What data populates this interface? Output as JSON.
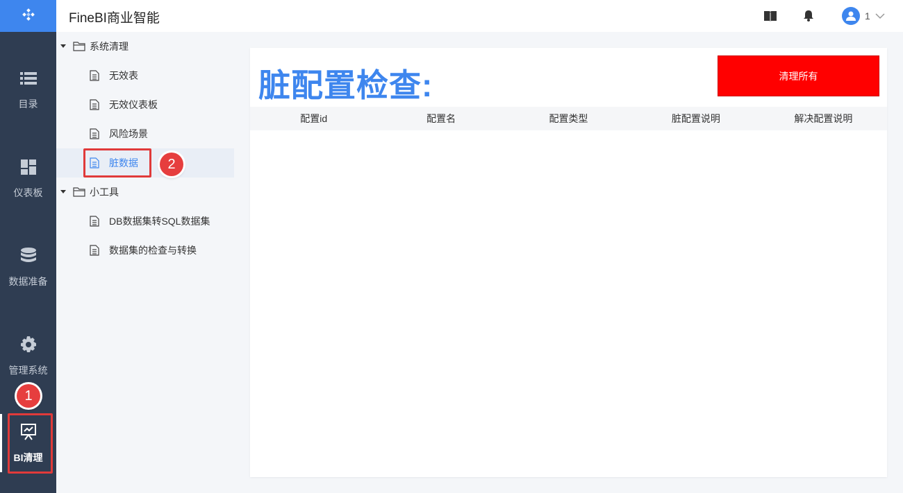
{
  "header": {
    "app_title": "FineBI商业智能",
    "username": "1"
  },
  "nav": {
    "items": [
      {
        "label": "目录",
        "icon": "list-icon"
      },
      {
        "label": "仪表板",
        "icon": "dashboard-icon"
      },
      {
        "label": "数据准备",
        "icon": "database-icon"
      },
      {
        "label": "管理系统",
        "icon": "gear-icon"
      },
      {
        "label": "BI清理",
        "icon": "presentation-icon"
      }
    ]
  },
  "badges": {
    "one": "1",
    "two": "2"
  },
  "tree": {
    "folders": [
      {
        "label": "系统清理",
        "children": [
          "无效表",
          "无效仪表板",
          "风险场景",
          "脏数据"
        ]
      },
      {
        "label": "小工具",
        "children": [
          "DB数据集转SQL数据集",
          "数据集的检查与转换"
        ]
      }
    ]
  },
  "main": {
    "title": "脏配置检查:",
    "clean_button": "清理所有",
    "columns": [
      "配置id",
      "配置名",
      "配置类型",
      "脏配置说明",
      "解决配置说明"
    ]
  },
  "colors": {
    "accent": "#3e86ee",
    "nav_bg": "#2f3d52",
    "danger": "#ff0000",
    "highlight": "#e03a3a"
  }
}
